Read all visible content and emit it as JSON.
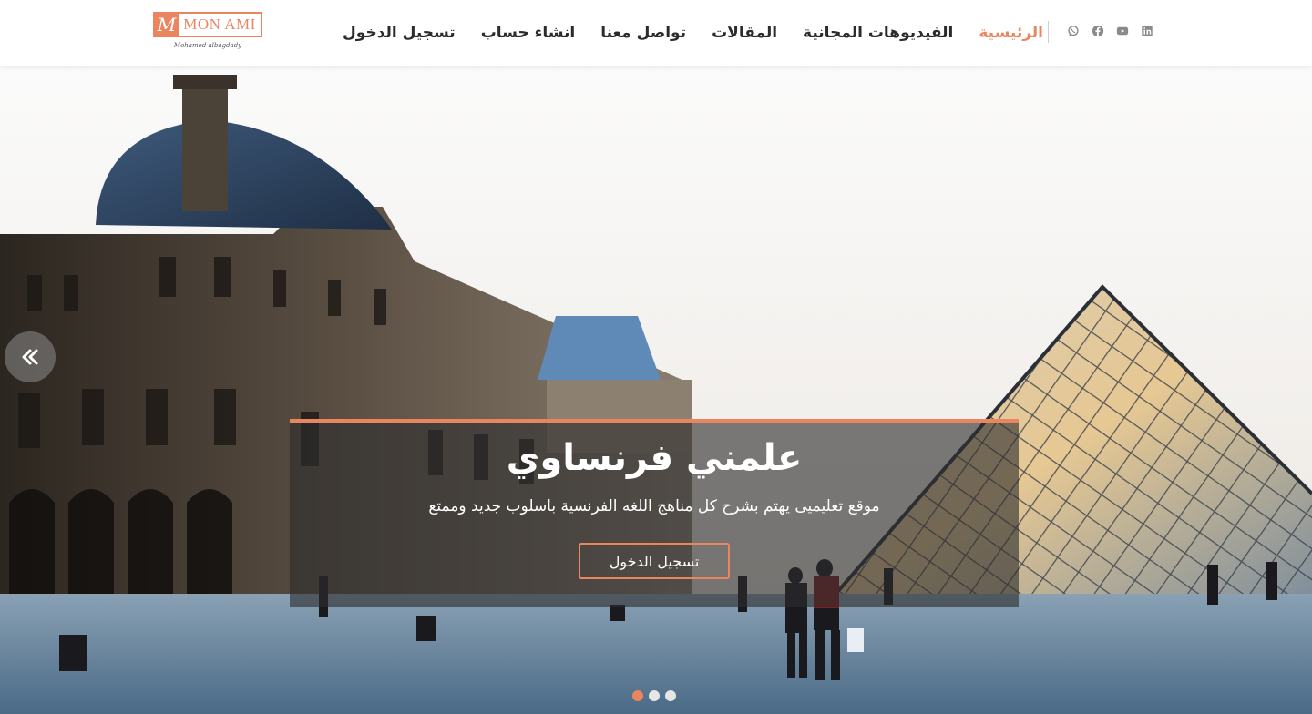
{
  "header": {
    "logo": {
      "brand": "MON AMI",
      "mark": "M",
      "tagline": "Mohamed albagdady"
    },
    "nav": [
      {
        "label": "الرئيسية",
        "active": true
      },
      {
        "label": "الفيديوهات المجانية",
        "active": false
      },
      {
        "label": "المقالات",
        "active": false
      },
      {
        "label": "تواصل معنا",
        "active": false
      },
      {
        "label": "انشاء حساب",
        "active": false
      },
      {
        "label": "تسجيل الدخول",
        "active": false
      }
    ],
    "socials": [
      "whatsapp-icon",
      "facebook-icon",
      "youtube-icon",
      "linkedin-icon"
    ]
  },
  "hero": {
    "title": "علمني فرنساوي",
    "subtitle": "موقع تعليميى يهتم بشرح كل مناهج اللغه الفرنسية باسلوب جديد وممتع",
    "button_label": "تسجيل الدخول",
    "prev_icon": "double-chevron-left-icon",
    "slides": {
      "count": 3,
      "active_index": 0
    }
  },
  "colors": {
    "accent": "#e9865f",
    "nav_text": "#2b2b2b",
    "caption_bg": "#2d2d2d"
  }
}
